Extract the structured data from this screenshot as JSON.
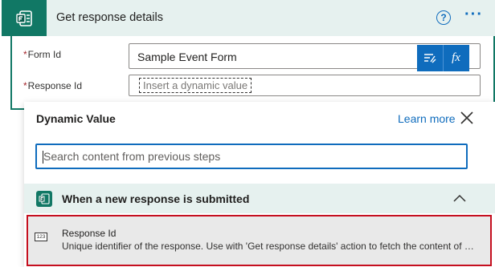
{
  "action": {
    "title": "Get response details",
    "icon": "microsoft-forms-icon",
    "accent_color": "#117865"
  },
  "fields": {
    "form_id": {
      "required_mark": "*",
      "label": "Form Id",
      "value": "Sample Event Form"
    },
    "response_id": {
      "required_mark": "*",
      "label": "Response Id",
      "placeholder": "Insert a dynamic value"
    }
  },
  "token_buttons": {
    "dynamic_icon": "dynamic-content-icon",
    "expression_label": "fx"
  },
  "dynamic_panel": {
    "title": "Dynamic Value",
    "learn_more": "Learn more",
    "search_placeholder": "Search content from previous steps",
    "search_value": "",
    "group": {
      "title": "When a new response is submitted",
      "icon": "microsoft-forms-icon",
      "items": [
        {
          "type_badge": "123",
          "name": "Response Id",
          "description": "Unique identifier of the response. Use with 'Get response details' action to fetch the content of t..."
        }
      ]
    }
  },
  "colors": {
    "primary_blue": "#0f6cbd",
    "header_tint": "#e6f1ef",
    "highlight_border": "#c50f1f",
    "required": "#a4262c"
  }
}
